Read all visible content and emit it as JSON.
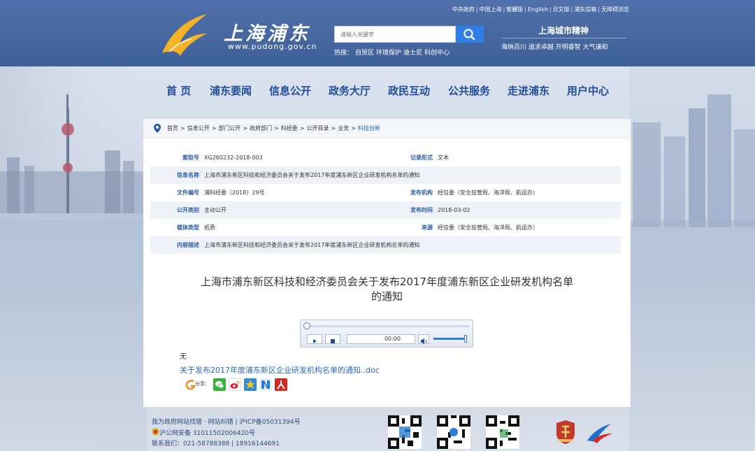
{
  "header": {
    "top_links": [
      "中央政府",
      "中国上海",
      "繁體版",
      "English",
      "日文版",
      "浦东信箱",
      "无障碍浏览"
    ],
    "logo_text": "上海浦东",
    "logo_url": "www.pudong.gov.cn",
    "search": {
      "placeholder": "请输入关键字",
      "hot_label": "热搜：",
      "hot_terms": [
        "自贸区",
        "环境保护",
        "迪士尼",
        "科创中心"
      ]
    },
    "spirit": {
      "title": "上海城市精神",
      "motto": "海纳百川 追求卓越 开明睿智 大气谦和"
    }
  },
  "nav": [
    "首 页",
    "浦东要闻",
    "信息公开",
    "政务大厅",
    "政民互动",
    "公共服务",
    "走进浦东",
    "用户中心"
  ],
  "breadcrumb": [
    "首页",
    "信息公开",
    "部门公开",
    "政府部门",
    "科经委",
    "公开目录",
    "业务",
    "科技创新"
  ],
  "meta": {
    "index_no": {
      "label": "索取号",
      "value": "XG260232-2018-003"
    },
    "record_form": {
      "label": "记录形式",
      "value": "文本"
    },
    "info_name": {
      "label": "信息名称",
      "value": "上海市浦东新区科技和经济委员会关于发布2017年度浦东新区企业研发机构名单的通知"
    },
    "doc_no": {
      "label": "文件编号",
      "value": "浦科经委〔2018〕29号"
    },
    "issuer": {
      "label": "发布机构",
      "value": "经信委（安全监管局、海洋局、航运办）"
    },
    "category": {
      "label": "公开类别",
      "value": "主动公开"
    },
    "publish_date": {
      "label": "发布时间",
      "value": "2018-03-02"
    },
    "carrier": {
      "label": "载体类型",
      "value": "纸质"
    },
    "source": {
      "label": "来源",
      "value": "经信委（安全监管局、海洋局、航运办）"
    },
    "description": {
      "label": "内容描述",
      "value": "上海市浦东新区科技和经济委员会关于发布2017年度浦东新区企业研发机构名单的通知"
    }
  },
  "document": {
    "title_line1": "上海市浦东新区科技和经济委员会关于发布2017年度浦东新区企业研发机构名单",
    "title_line2": "的通知",
    "player_time": "00:00",
    "player_progress": 0,
    "volume_level": 1.0,
    "body_text": "无",
    "attachment": "关于发布2017年度浦东新区企业研发机构名单的通知..doc",
    "share_label": "分享："
  },
  "footer": {
    "line1_a": "我为政府网站找错",
    "line1_b": "网站纠错",
    "line1_c": "沪ICP备05031394号",
    "line2": "沪公网安备 31011502006420号",
    "line3": "联系我们：021-58788388 | 18916144691"
  },
  "colors": {
    "header_bg": "#4566a0",
    "nav_text": "#1f4d98",
    "link": "#2b6ab8",
    "search_button": "#2f7ee6"
  }
}
